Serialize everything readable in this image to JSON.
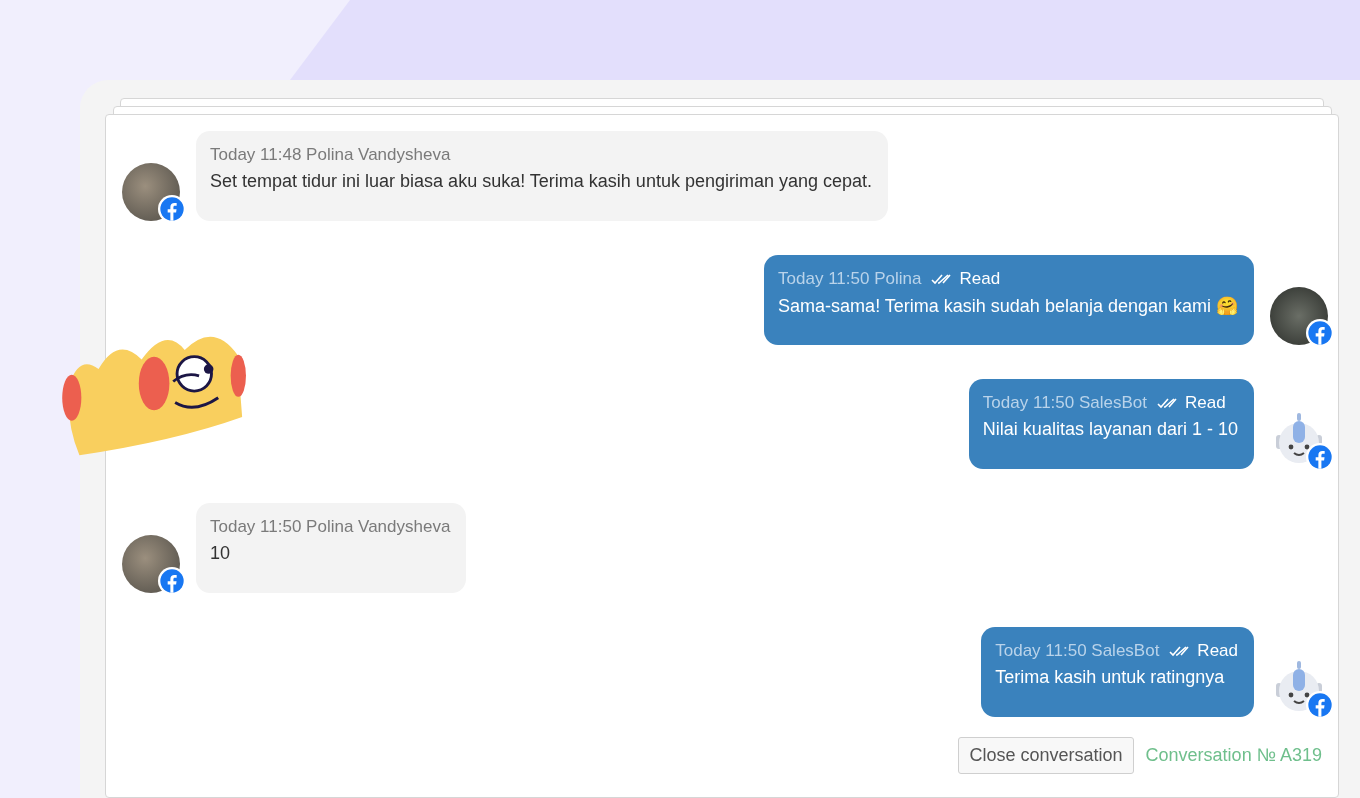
{
  "messages": [
    {
      "kind": "incoming",
      "time": "Today 11:48",
      "author": "Polina Vandysheva",
      "text": "Set tempat tidur ini luar biasa aku suka! Terima kasih untuk pengiriman yang cepat.",
      "avatar": {
        "kind": "photo"
      }
    },
    {
      "kind": "outgoing",
      "time": "Today 11:50",
      "author": "Polina",
      "status": "Read",
      "text": "Sama-sama! Terima kasih sudah belanja dengan kami 🤗",
      "avatar": {
        "kind": "photo"
      }
    },
    {
      "kind": "outgoing",
      "time": "Today 11:50",
      "author": "SalesBot",
      "status": "Read",
      "text": "Nilai kualitas layanan dari 1 - 10",
      "avatar": {
        "kind": "bot"
      }
    },
    {
      "kind": "incoming",
      "time": "Today 11:50",
      "author": "Polina Vandysheva",
      "text": "10",
      "avatar": {
        "kind": "photo"
      }
    },
    {
      "kind": "outgoing",
      "time": "Today 11:50",
      "author": "SalesBot",
      "status": "Read",
      "text": "Terima kasih untuk ratingnya",
      "avatar": {
        "kind": "bot"
      }
    }
  ],
  "footer": {
    "button": "Close conversation",
    "conversation": "Conversation № A319"
  }
}
